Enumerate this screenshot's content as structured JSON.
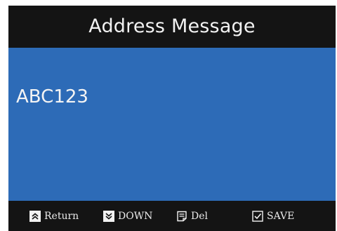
{
  "screen": {
    "title": "Address Message",
    "address_value": "ABC123"
  },
  "footer": {
    "keys": [
      {
        "label": "Return",
        "icon": "double-chevron-up-icon"
      },
      {
        "label": "DOWN",
        "icon": "double-chevron-down-icon"
      },
      {
        "label": "Del",
        "icon": "document-icon"
      },
      {
        "label": "SAVE",
        "icon": "checkbox-icon"
      }
    ]
  },
  "colors": {
    "title_bar_bg": "#141414",
    "content_bg": "#2d6bb7",
    "text": "#f4f4f4"
  }
}
